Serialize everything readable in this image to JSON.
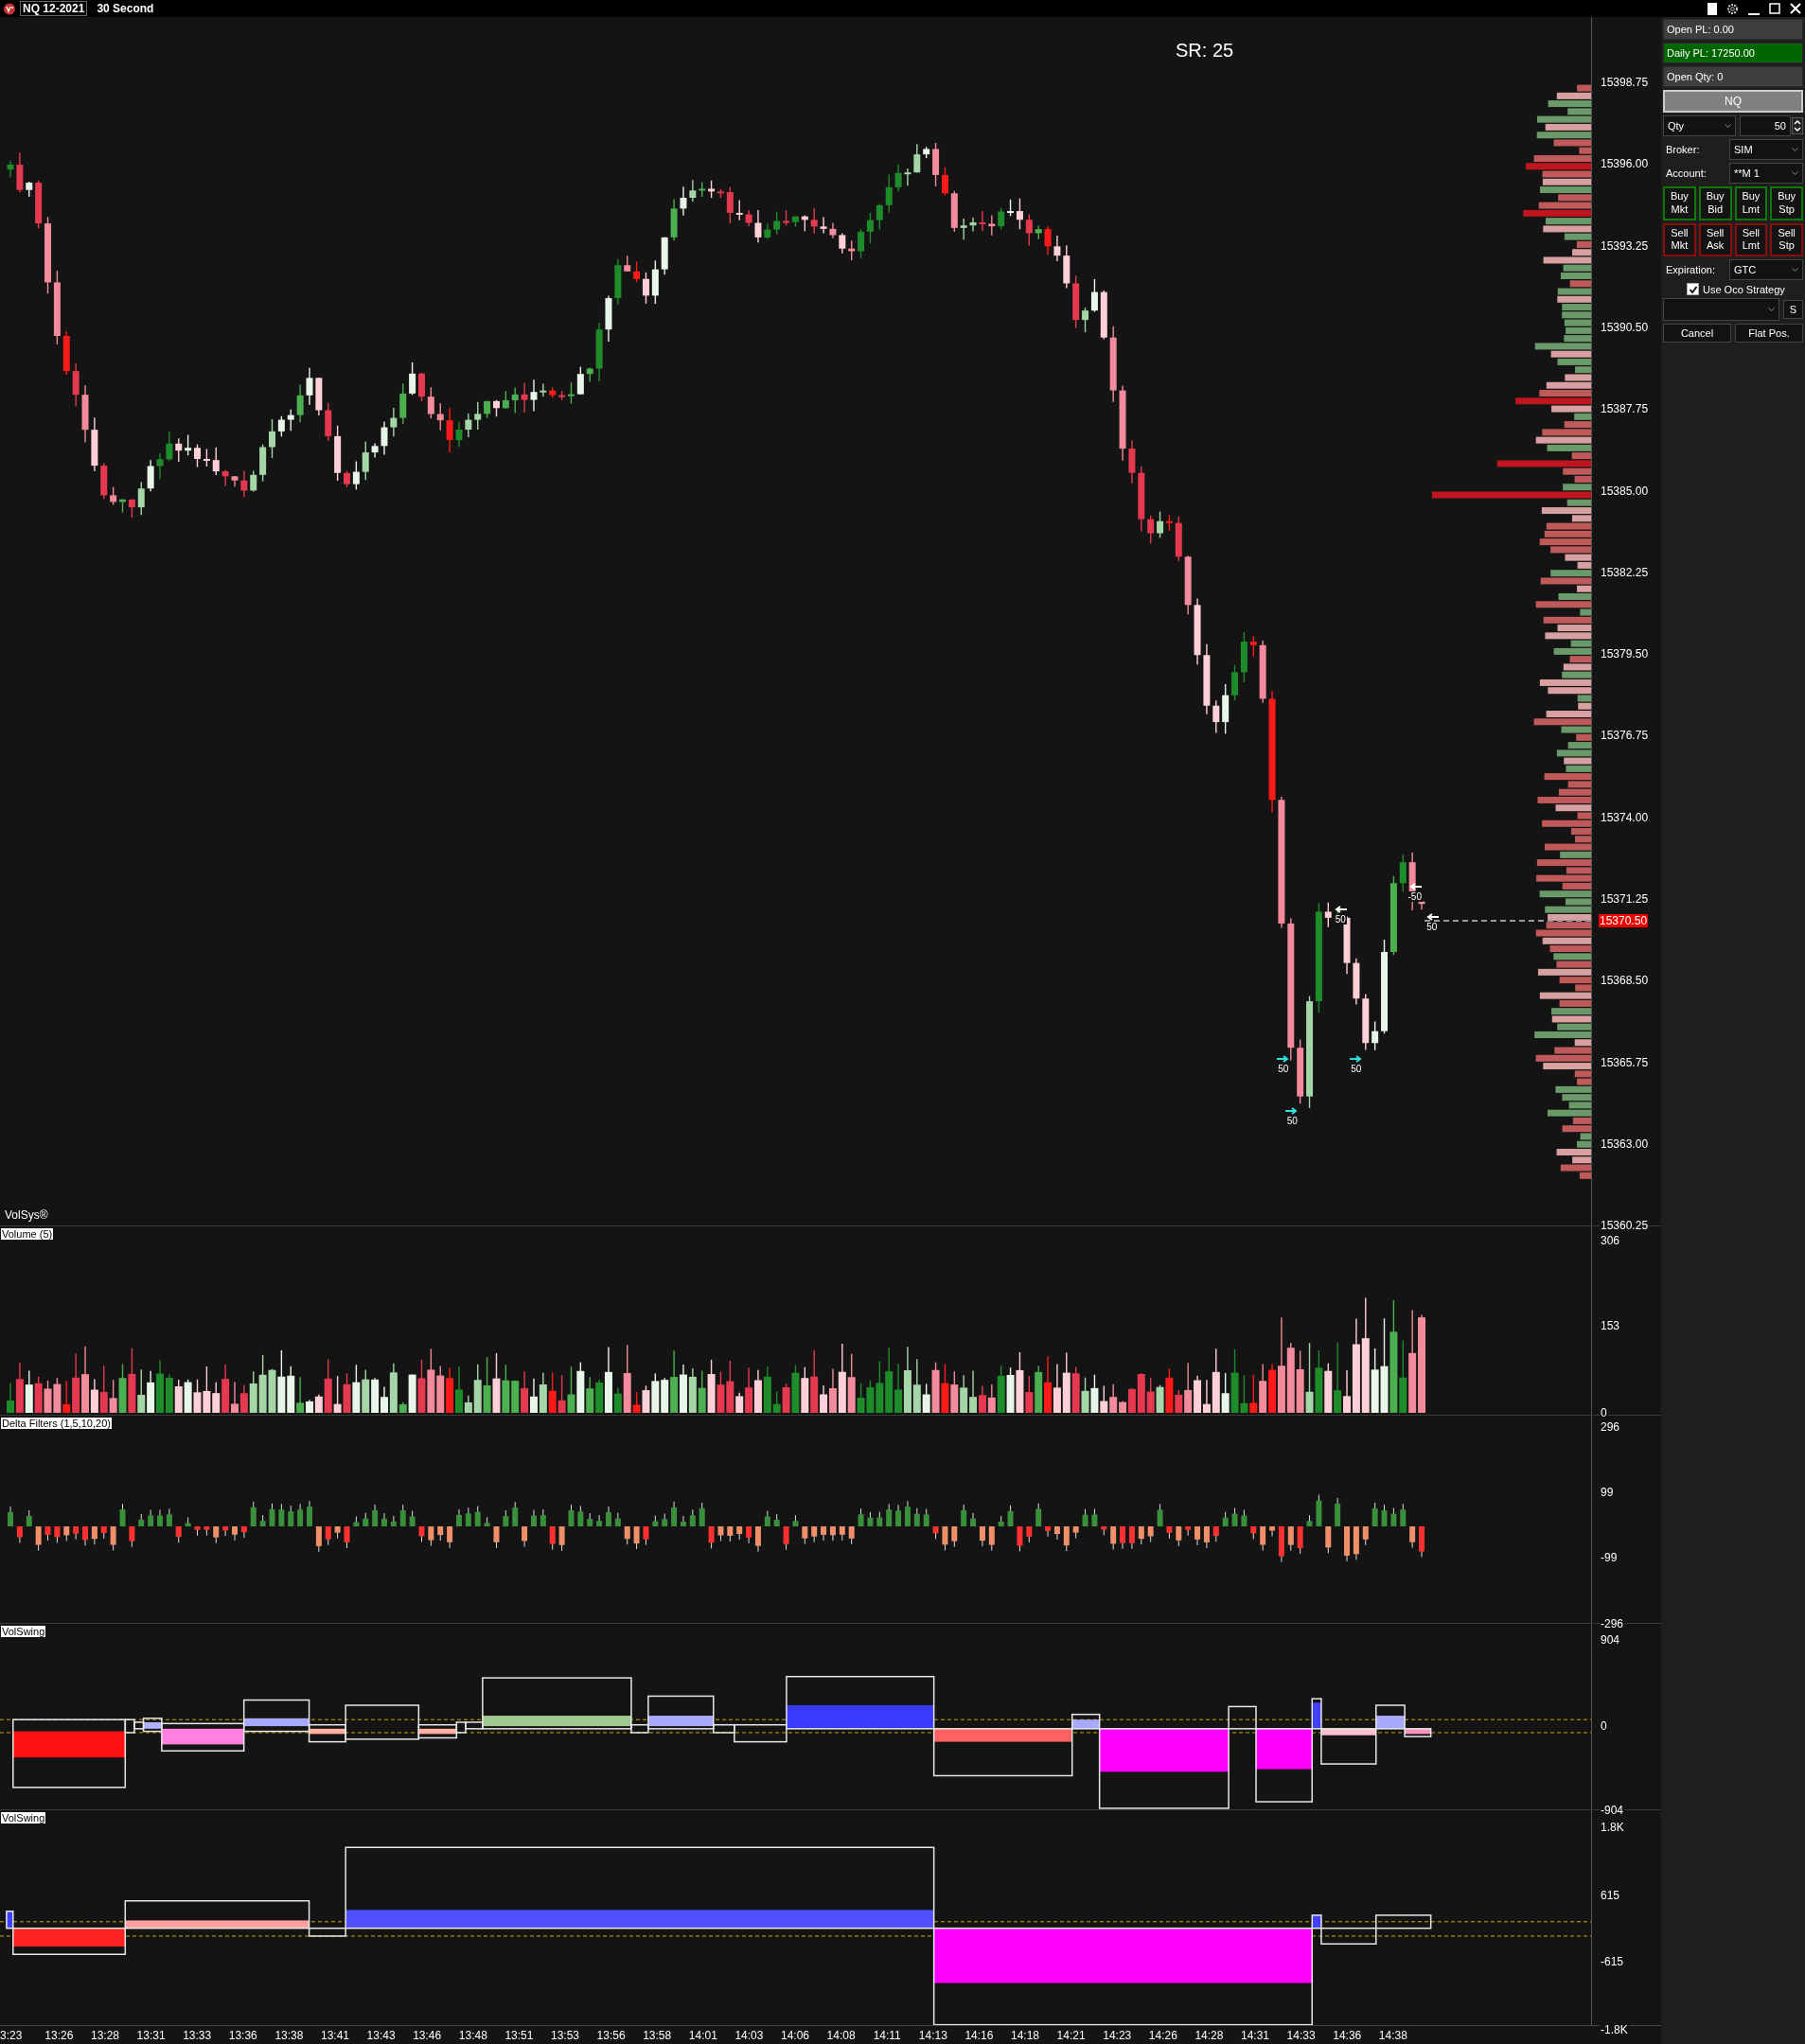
{
  "title_bar": {
    "instrument": "NQ 12-2021",
    "interval": "30 Second"
  },
  "price_panel": {
    "sr_label": "SR: 25",
    "indicator": "VolSys®",
    "axis": [
      "15398.75",
      "15396.00",
      "15393.25",
      "15390.50",
      "15387.75",
      "15385.00",
      "15382.25",
      "15379.50",
      "15376.75",
      "15374.00",
      "15371.25",
      "15368.50",
      "15365.75",
      "15363.00",
      "15360.25"
    ],
    "last_price": "15370.50",
    "fills": [
      {
        "label": "50",
        "kind": "buy"
      },
      {
        "label": "50",
        "kind": "buy"
      },
      {
        "label": "50",
        "kind": "buy"
      },
      {
        "label": "50",
        "kind": "sell"
      },
      {
        "label": "-50",
        "kind": "sell"
      },
      {
        "label": "50",
        "kind": "sell"
      }
    ]
  },
  "volume_panel": {
    "label": "Volume (5)",
    "axis": [
      "306",
      "153",
      "0"
    ]
  },
  "delta_panel": {
    "label": "Delta Filters (1,5,10,20)",
    "axis": [
      "296",
      "99",
      "-99",
      "-296"
    ]
  },
  "swing_panels": [
    {
      "label": "VolSwing",
      "axis": [
        "904",
        "0",
        "-904"
      ]
    },
    {
      "label": "VolSwing",
      "axis": [
        "1.8K",
        "615",
        "-615",
        "-1.8K"
      ]
    }
  ],
  "time_axis": [
    "3:23",
    "13:26",
    "13:28",
    "13:31",
    "13:33",
    "13:36",
    "13:38",
    "13:41",
    "13:43",
    "13:46",
    "13:48",
    "13:51",
    "13:53",
    "13:56",
    "13:58",
    "14:01",
    "14:03",
    "14:06",
    "14:08",
    "14:11",
    "14:13",
    "14:16",
    "14:18",
    "14:21",
    "14:23",
    "14:26",
    "14:28",
    "14:31",
    "14:33",
    "14:36",
    "14:38"
  ],
  "order_panel": {
    "open_pl": "Open PL: 0.00",
    "daily_pl": "Daily PL: 17250.00",
    "open_qty": "Open Qty: 0",
    "instrument": "NQ",
    "qty_mode": "Qty",
    "qty": "50",
    "broker_label": "Broker:",
    "broker": "SIM",
    "account_label": "Account:",
    "account": "**M 1",
    "buttons": [
      {
        "label": "Buy Mkt",
        "kind": "buy"
      },
      {
        "label": "Buy Bid",
        "kind": "buy"
      },
      {
        "label": "Buy Lmt",
        "kind": "buy"
      },
      {
        "label": "Buy Stp",
        "kind": "buy"
      },
      {
        "label": "Sell Mkt",
        "kind": "sell"
      },
      {
        "label": "Sell Ask",
        "kind": "sell"
      },
      {
        "label": "Sell Lmt",
        "kind": "sell"
      },
      {
        "label": "Sell Stp",
        "kind": "sell"
      }
    ],
    "expiration_label": "Expiration:",
    "expiration": "GTC",
    "oco": {
      "label": "Use Oco Strategy",
      "checked": true
    },
    "strategy_button": "S",
    "cancel": "Cancel",
    "flat": "Flat Pos."
  }
}
